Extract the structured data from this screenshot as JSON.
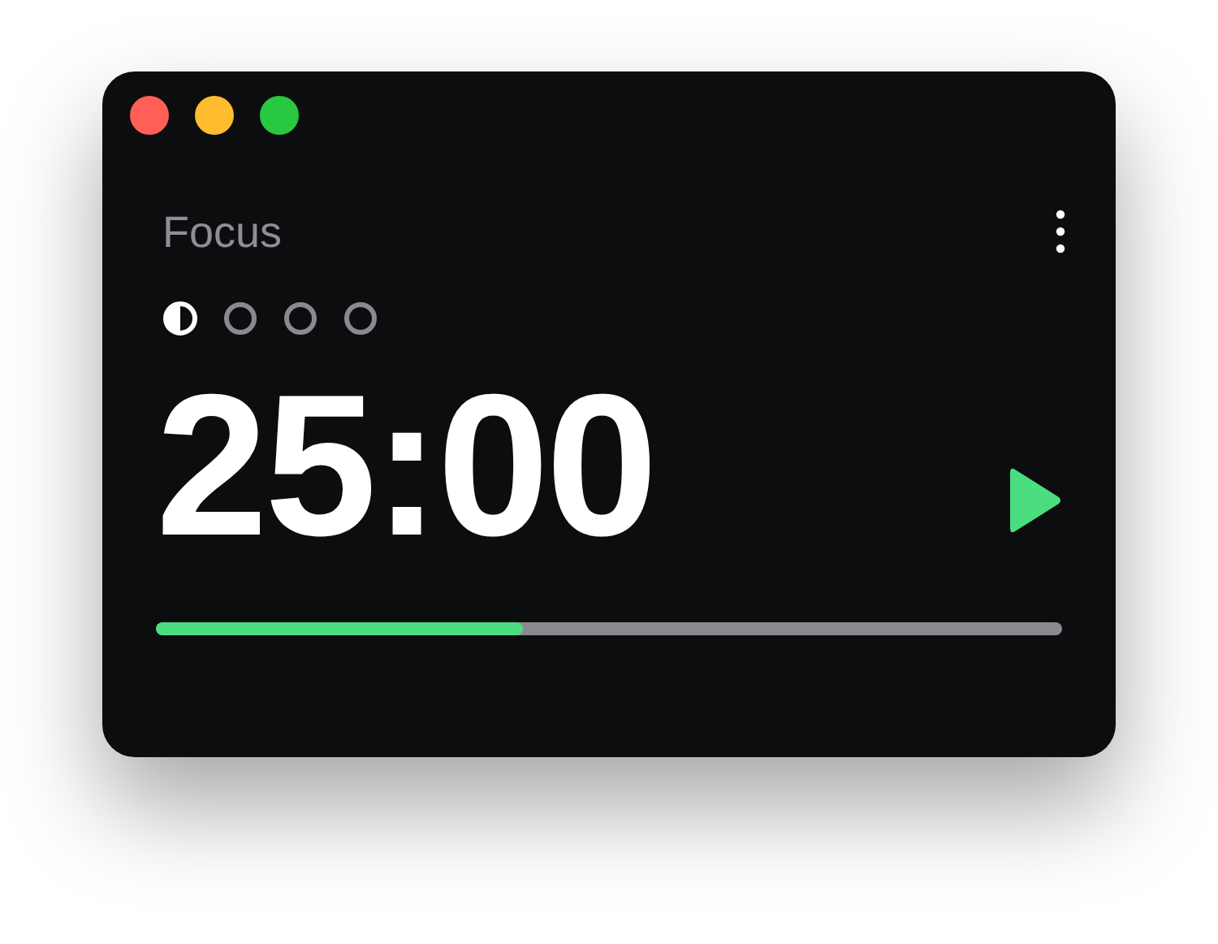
{
  "window": {
    "title": "Focus"
  },
  "sessions": [
    {
      "kind": "current"
    },
    {
      "kind": "pending"
    },
    {
      "kind": "pending"
    },
    {
      "kind": "pending"
    }
  ],
  "timer": {
    "time": "25:00",
    "running": false
  },
  "progress": {
    "level": 0.405
  }
}
